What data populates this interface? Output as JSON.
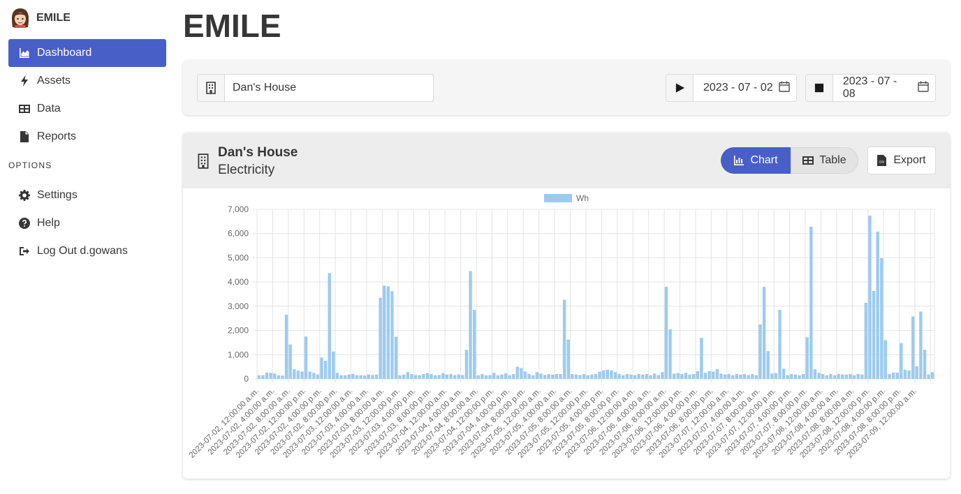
{
  "app": {
    "brand": "EMILE",
    "page_title": "EMILE"
  },
  "sidebar": {
    "items": [
      {
        "label": "Dashboard",
        "icon": "chart-area-icon",
        "active": true
      },
      {
        "label": "Assets",
        "icon": "bolt-icon",
        "active": false
      },
      {
        "label": "Data",
        "icon": "table-icon",
        "active": false
      },
      {
        "label": "Reports",
        "icon": "file-icon",
        "active": false
      }
    ],
    "options_label": "OPTIONS",
    "options": [
      {
        "label": "Settings",
        "icon": "gear-icon"
      },
      {
        "label": "Help",
        "icon": "question-circle-icon"
      },
      {
        "label": "Log Out d.gowans",
        "icon": "sign-out-icon"
      }
    ]
  },
  "filters": {
    "site_value": "Dan's House",
    "start_date": "2023 - 07 - 02",
    "end_date": "2023 - 07 - 08"
  },
  "card": {
    "title": "Dan's House",
    "subtitle": "Electricity",
    "chart_label": "Chart",
    "table_label": "Table",
    "export_label": "Export"
  },
  "colors": {
    "accent": "#485fc7",
    "bar": "#9ccbf0"
  },
  "chart_data": {
    "type": "bar",
    "legend": "Wh",
    "ylim": [
      0,
      7000
    ],
    "yticks": [
      "0",
      "1,000",
      "2,000",
      "3,000",
      "4,000",
      "5,000",
      "6,000",
      "7,000"
    ],
    "xtick_labels": [
      "2023-07-02, 12:00:00 a.m.",
      "2023-07-02, 4:00:00 a.m.",
      "2023-07-02, 8:00:00 a.m.",
      "2023-07-02, 12:00:00 p.m.",
      "2023-07-02, 4:00:00 p.m.",
      "2023-07-02, 8:00:00 p.m.",
      "2023-07-03, 12:00:00 a.m.",
      "2023-07-03, 4:00:00 a.m.",
      "2023-07-03, 8:00:00 a.m.",
      "2023-07-03, 12:00:00 p.m.",
      "2023-07-03, 4:00:00 p.m.",
      "2023-07-03, 8:00:00 p.m.",
      "2023-07-04, 12:00:00 a.m.",
      "2023-07-04, 4:00:00 a.m.",
      "2023-07-04, 8:00:00 a.m.",
      "2023-07-04, 12:00:00 p.m.",
      "2023-07-04, 4:00:00 p.m.",
      "2023-07-04, 8:00:00 p.m.",
      "2023-07-05, 12:00:00 a.m.",
      "2023-07-05, 4:00:00 a.m.",
      "2023-07-05, 8:00:00 a.m.",
      "2023-07-05, 12:00:00 p.m.",
      "2023-07-05, 4:00:00 p.m.",
      "2023-07-05, 8:00:00 p.m.",
      "2023-07-06, 12:00:00 a.m.",
      "2023-07-06, 4:00:00 a.m.",
      "2023-07-06, 8:00:00 a.m.",
      "2023-07-06, 12:00:00 p.m.",
      "2023-07-06, 4:00:00 p.m.",
      "2023-07-06, 8:00:00 p.m.",
      "2023-07-07, 12:00:00 a.m.",
      "2023-07-07, 4:00:00 a.m.",
      "2023-07-07, 8:00:00 a.m.",
      "2023-07-07, 12:00:00 p.m.",
      "2023-07-07, 4:00:00 p.m.",
      "2023-07-07, 8:00:00 p.m.",
      "2023-07-08, 12:00:00 a.m.",
      "2023-07-08, 4:00:00 a.m.",
      "2023-07-08, 8:00:00 a.m.",
      "2023-07-08, 12:00:00 p.m.",
      "2023-07-08, 4:00:00 p.m.",
      "2023-07-08, 8:00:00 p.m.",
      "2023-07-09, 12:00:00 a.m."
    ],
    "values": [
      150,
      150,
      260,
      250,
      220,
      150,
      140,
      2650,
      1420,
      400,
      340,
      300,
      1750,
      300,
      250,
      180,
      880,
      750,
      4370,
      1130,
      250,
      150,
      150,
      180,
      200,
      150,
      150,
      140,
      180,
      160,
      180,
      3350,
      3850,
      3820,
      3620,
      1740,
      150,
      180,
      280,
      200,
      160,
      150,
      200,
      240,
      200,
      150,
      160,
      240,
      180,
      200,
      150,
      180,
      160,
      1200,
      4450,
      2850,
      150,
      200,
      150,
      160,
      250,
      150,
      180,
      230,
      150,
      200,
      500,
      450,
      300,
      200,
      150,
      280,
      220,
      160,
      200,
      180,
      200,
      200,
      3270,
      1620,
      200,
      180,
      160,
      200,
      150,
      180,
      200,
      300,
      350,
      380,
      350,
      280,
      200,
      150,
      200,
      180,
      150,
      200,
      180,
      200,
      150,
      220,
      160,
      280,
      3800,
      2050,
      220,
      240,
      200,
      250,
      180,
      200,
      320,
      1700,
      250,
      320,
      300,
      400,
      220,
      180,
      200,
      150,
      200,
      180,
      200,
      160,
      200,
      150,
      2250,
      3800,
      1150,
      220,
      240,
      2850,
      420,
      150,
      200,
      180,
      150,
      200,
      1720,
      6280,
      400,
      250,
      200,
      150,
      200,
      150,
      200,
      180,
      180,
      200,
      150,
      200,
      180,
      3140,
      6740,
      3630,
      6080,
      4980,
      1600,
      200,
      260,
      260,
      1480,
      380,
      350,
      2580,
      520,
      2780,
      1200,
      180,
      280
    ]
  }
}
